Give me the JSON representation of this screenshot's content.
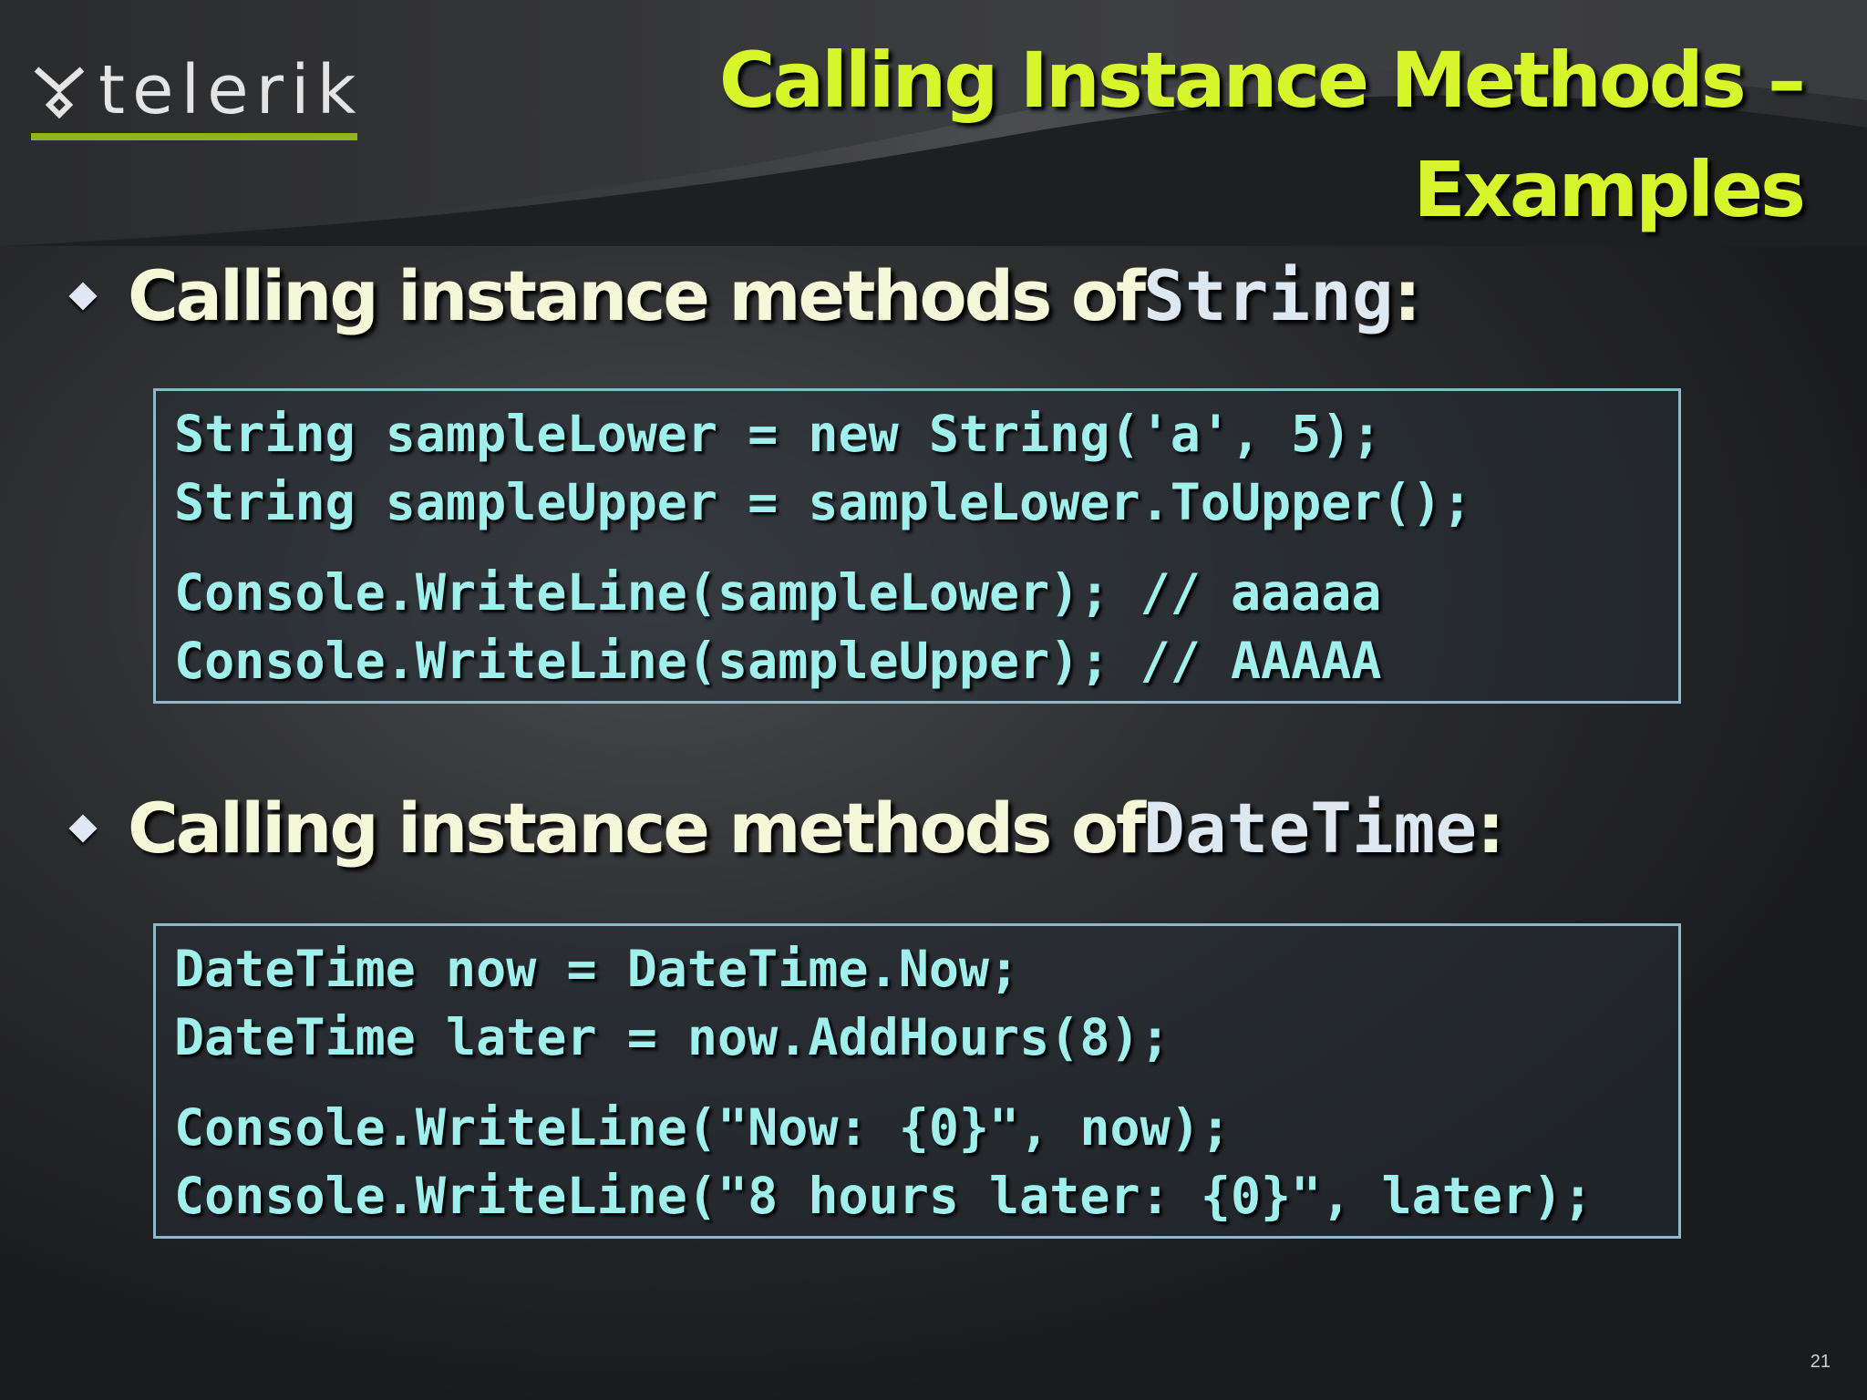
{
  "logo": {
    "name": "telerik",
    "mark_icon": "telerik-logo-mark-icon"
  },
  "title": {
    "line1": "Calling Instance Methods –",
    "line2": "Examples"
  },
  "sections": [
    {
      "bullet_text": "Calling instance methods of ",
      "bullet_code": "String",
      "bullet_suffix": ":",
      "code_groups": [
        [
          "String sampleLower = new String('a', 5);",
          "String sampleUpper = sampleLower.ToUpper();"
        ],
        [
          "Console.WriteLine(sampleLower); // aaaaa",
          "Console.WriteLine(sampleUpper); // AAAAA"
        ]
      ]
    },
    {
      "bullet_text": "Calling instance methods of ",
      "bullet_code": "DateTime",
      "bullet_suffix": ":",
      "code_groups": [
        [
          "DateTime now = DateTime.Now;",
          "DateTime later = now.AddHours(8);"
        ],
        [
          "Console.WriteLine(\"Now: {0}\", now);",
          "Console.WriteLine(\"8 hours later: {0}\", later);"
        ]
      ]
    }
  ],
  "page_number": "21",
  "colors": {
    "title": "#d6f52a",
    "code": "#9ff0ec",
    "code_border": "#8fb9cb",
    "logo_underline": "#8fb321"
  }
}
